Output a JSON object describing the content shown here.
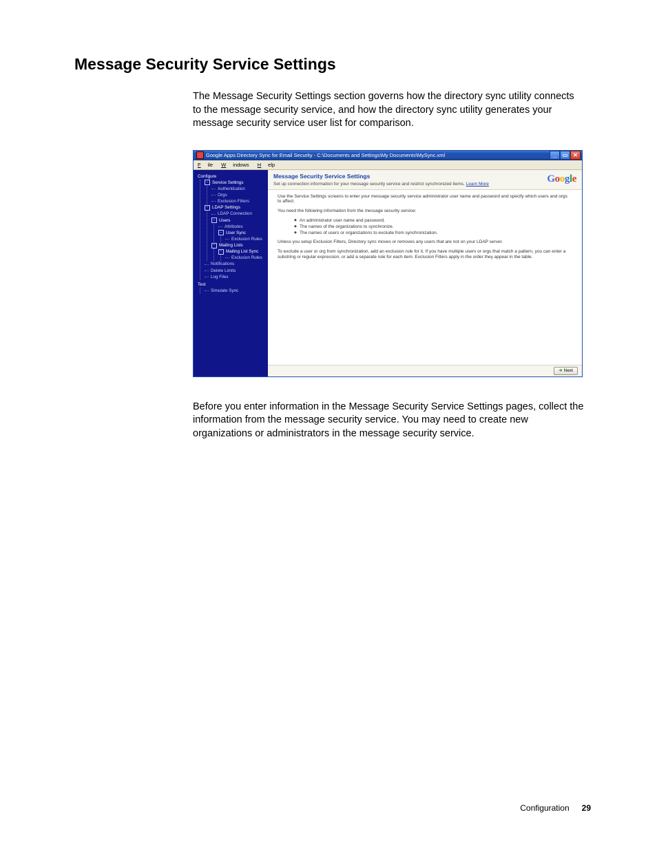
{
  "page": {
    "heading": "Message Security Service Settings",
    "intro": "The Message Security Settings section governs how the directory sync utility connects to the message security service, and how the directory sync utility generates your message security service user list for comparison.",
    "outro": "Before you enter information in the Message Security Service Settings pages, collect the information from the message security service. You may need to create new organizations or administrators in the message security service."
  },
  "footer": {
    "section": "Configuration",
    "page_num": "29"
  },
  "app": {
    "title": "Google Apps Directory Sync for Email Security - C:\\Documents and Settings\\My Documents\\MySync.xml",
    "menu": {
      "file": "File",
      "windows": "Windows",
      "help": "Help"
    },
    "brand": "Google",
    "sidebar": {
      "configure": "Configure",
      "service_settings": "Service Settings",
      "authentication": "Authentication",
      "orgs": "Orgs",
      "exclusion_filters": "Exclusion Filters",
      "ldap_settings": "LDAP Settings",
      "ldap_connection": "LDAP Connection",
      "users": "Users",
      "attributes": "Attributes",
      "user_sync": "User Sync",
      "mailing_lists": "Mailing Lists",
      "mailing_list_sync": "Mailing List Sync",
      "notifications": "Notifications",
      "delete_limits": "Delete Limits",
      "log_files": "Log Files",
      "test": "Test",
      "simulate_sync": "Simulate Sync"
    },
    "content": {
      "title": "Message Security Service Settings",
      "subtitle": "Set up connection information for your message security service and restrict synchronized items.",
      "learn_more": "Learn More",
      "p1": "Use the Service Settings screens to enter your message security service administrator user name and password and specify which users and orgs to affect.",
      "p2": "You need the following information from the message security service:",
      "b1": "An administrator user name and password.",
      "b2": "The names of the organizations to synchronize.",
      "b3": "The names of users or organizations to exclude from synchronization.",
      "p3": "Unless you setup Exclusion Filters, Directory sync moves or removes any users that are not on your LDAP server.",
      "p4": "To exclude a user or org from synchronization, add an exclusion rule for it. If you have multiple users or orgs that match a pattern, you can enter a substring or regular expression, or add a separate rule for each item. Exclusion Filters apply in the order they appear in the table.",
      "next": "Next"
    }
  }
}
